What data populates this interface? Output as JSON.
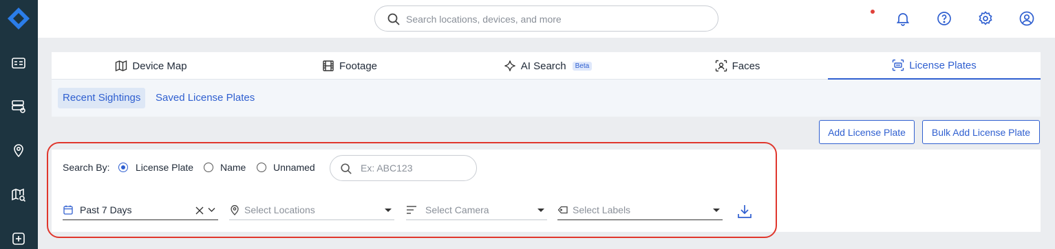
{
  "search": {
    "placeholder": "Search locations, devices, and more"
  },
  "tabs": [
    {
      "label": "Device Map",
      "icon": "map-icon"
    },
    {
      "label": "Footage",
      "icon": "film-icon"
    },
    {
      "label": "AI Search",
      "icon": "sparkle-icon",
      "badge": "Beta"
    },
    {
      "label": "Faces",
      "icon": "face-scan-icon"
    },
    {
      "label": "License Plates",
      "icon": "license-plate-icon",
      "active": true
    }
  ],
  "subtabs": [
    {
      "label": "Recent Sightings",
      "active": true
    },
    {
      "label": "Saved License Plates"
    }
  ],
  "actions": {
    "add_label": "Add License Plate",
    "bulk_add_label": "Bulk Add License Plate"
  },
  "filters": {
    "search_by_label": "Search By:",
    "radios": [
      {
        "label": "License Plate",
        "selected": true
      },
      {
        "label": "Name"
      },
      {
        "label": "Unnamed"
      }
    ],
    "plate_placeholder": "Ex: ABC123",
    "date_range": "Past 7 Days",
    "locations_placeholder": "Select Locations",
    "camera_placeholder": "Select Camera",
    "labels_placeholder": "Select Labels"
  },
  "colors": {
    "accent": "#2f5fd0",
    "sidebar": "#1d3440",
    "highlight": "#e0362c",
    "notification": "#e0413a"
  }
}
